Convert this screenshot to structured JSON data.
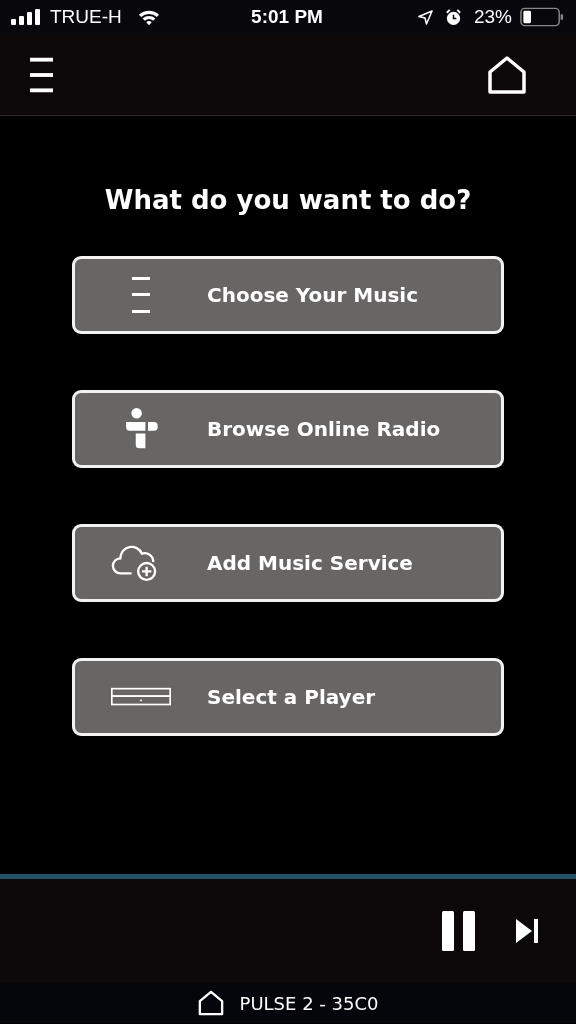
{
  "status_bar": {
    "carrier": "TRUE-H",
    "time": "5:01 PM",
    "battery": "23%"
  },
  "prompt": "What do you want to do?",
  "actions": [
    {
      "kind": "library",
      "label": "Choose Your Music"
    },
    {
      "kind": "radio",
      "label": "Browse Online Radio"
    },
    {
      "kind": "cloud",
      "label": "Add Music Service"
    },
    {
      "kind": "player",
      "label": "Select a Player"
    }
  ],
  "now_playing": {
    "player": "PULSE 2 - 35C0"
  }
}
